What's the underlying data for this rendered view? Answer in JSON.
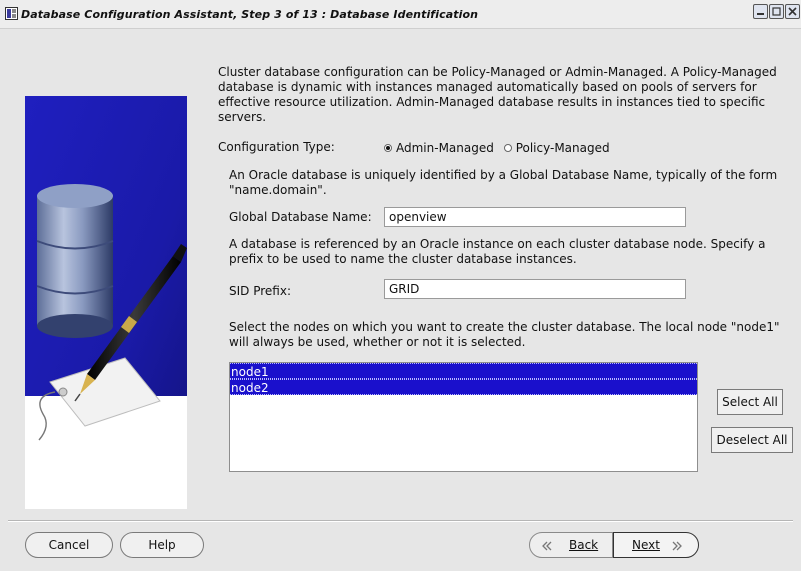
{
  "window": {
    "title": "Database Configuration Assistant, Step 3 of 13 : Database Identification"
  },
  "intro_text": "Cluster database configuration can be Policy-Managed or Admin-Managed. A Policy-Managed database is dynamic with instances managed automatically based on pools of servers for effective resource utilization. Admin-Managed database results in instances tied to specific servers.",
  "config_type": {
    "label": "Configuration Type:",
    "options": [
      {
        "label": "Admin-Managed",
        "selected": true
      },
      {
        "label": "Policy-Managed",
        "selected": false
      }
    ]
  },
  "global_db": {
    "description": "An Oracle database is uniquely identified by a Global Database Name, typically of the form \"name.domain\".",
    "label": "Global Database Name:",
    "value": "openview"
  },
  "sid": {
    "description": "A database is referenced by an Oracle instance on each cluster database node. Specify a prefix to be used to name the cluster database instances.",
    "label": "SID Prefix:",
    "value": "GRID"
  },
  "nodes": {
    "description": "Select the nodes on which you want to create the cluster database. The local node \"node1\" will always be used, whether or not it is selected.",
    "items": [
      "node1",
      "node2"
    ],
    "select_all": "Select All",
    "deselect_all": "Deselect All"
  },
  "footer": {
    "cancel": "Cancel",
    "help": "Help",
    "back": "Back",
    "next": "Next"
  },
  "colors": {
    "selection": "#1a10cc",
    "side_panel": "#1a1ab4"
  }
}
